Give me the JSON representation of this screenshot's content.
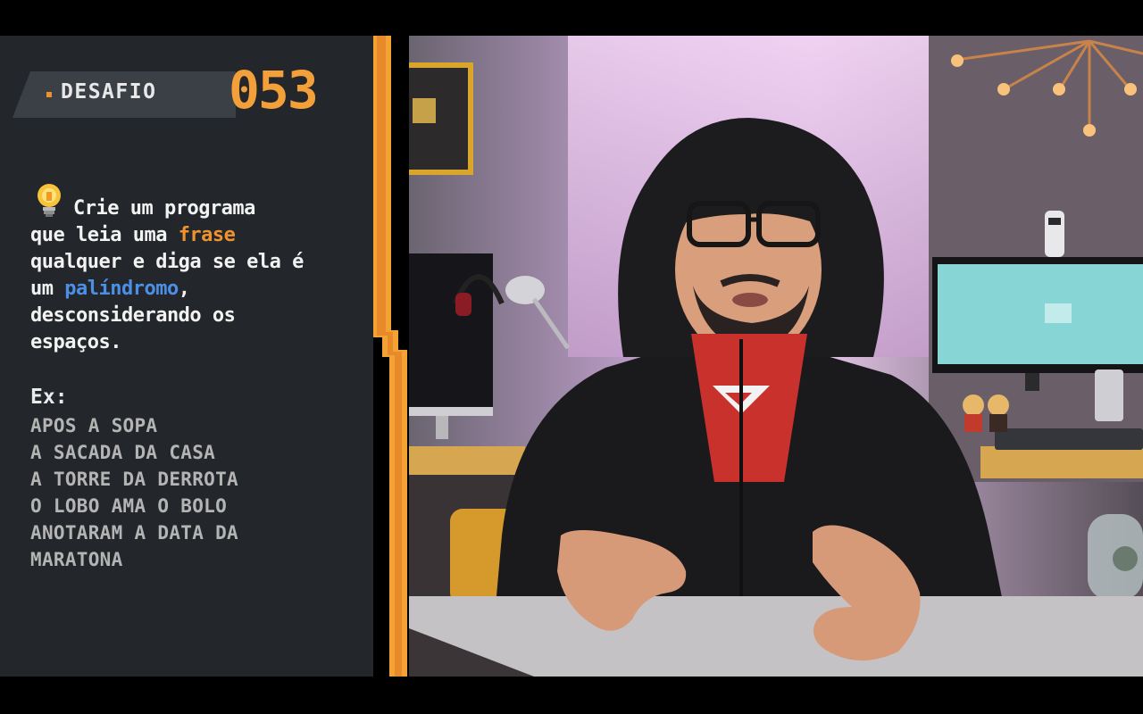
{
  "challenge": {
    "title": "DESAFIO",
    "number": "053"
  },
  "description": {
    "line1": "Crie um programa",
    "line2_before": "que leia uma ",
    "line2_highlight": "frase",
    "line3": "qualquer e diga se ela é",
    "line4_before": "um ",
    "line4_highlight": "palíndromo",
    "line4_after": ",",
    "line5": "desconsiderando os",
    "line6": "espaços."
  },
  "examples": {
    "label": "Ex:",
    "items": [
      "APOS A SOPA",
      "A SACADA DA CASA",
      "A TORRE DA DERROTA",
      "O LOBO AMA O BOLO",
      "ANOTARAM A DATA DA",
      "MARATONA"
    ]
  },
  "colors": {
    "panel_bg": "#23272b",
    "accent_orange": "#f4a03a",
    "accent_blue": "#4c8fe6",
    "text_light": "#f2f2f2",
    "text_muted": "#b4b4b4"
  },
  "icons": [
    "lightbulb-icon"
  ]
}
